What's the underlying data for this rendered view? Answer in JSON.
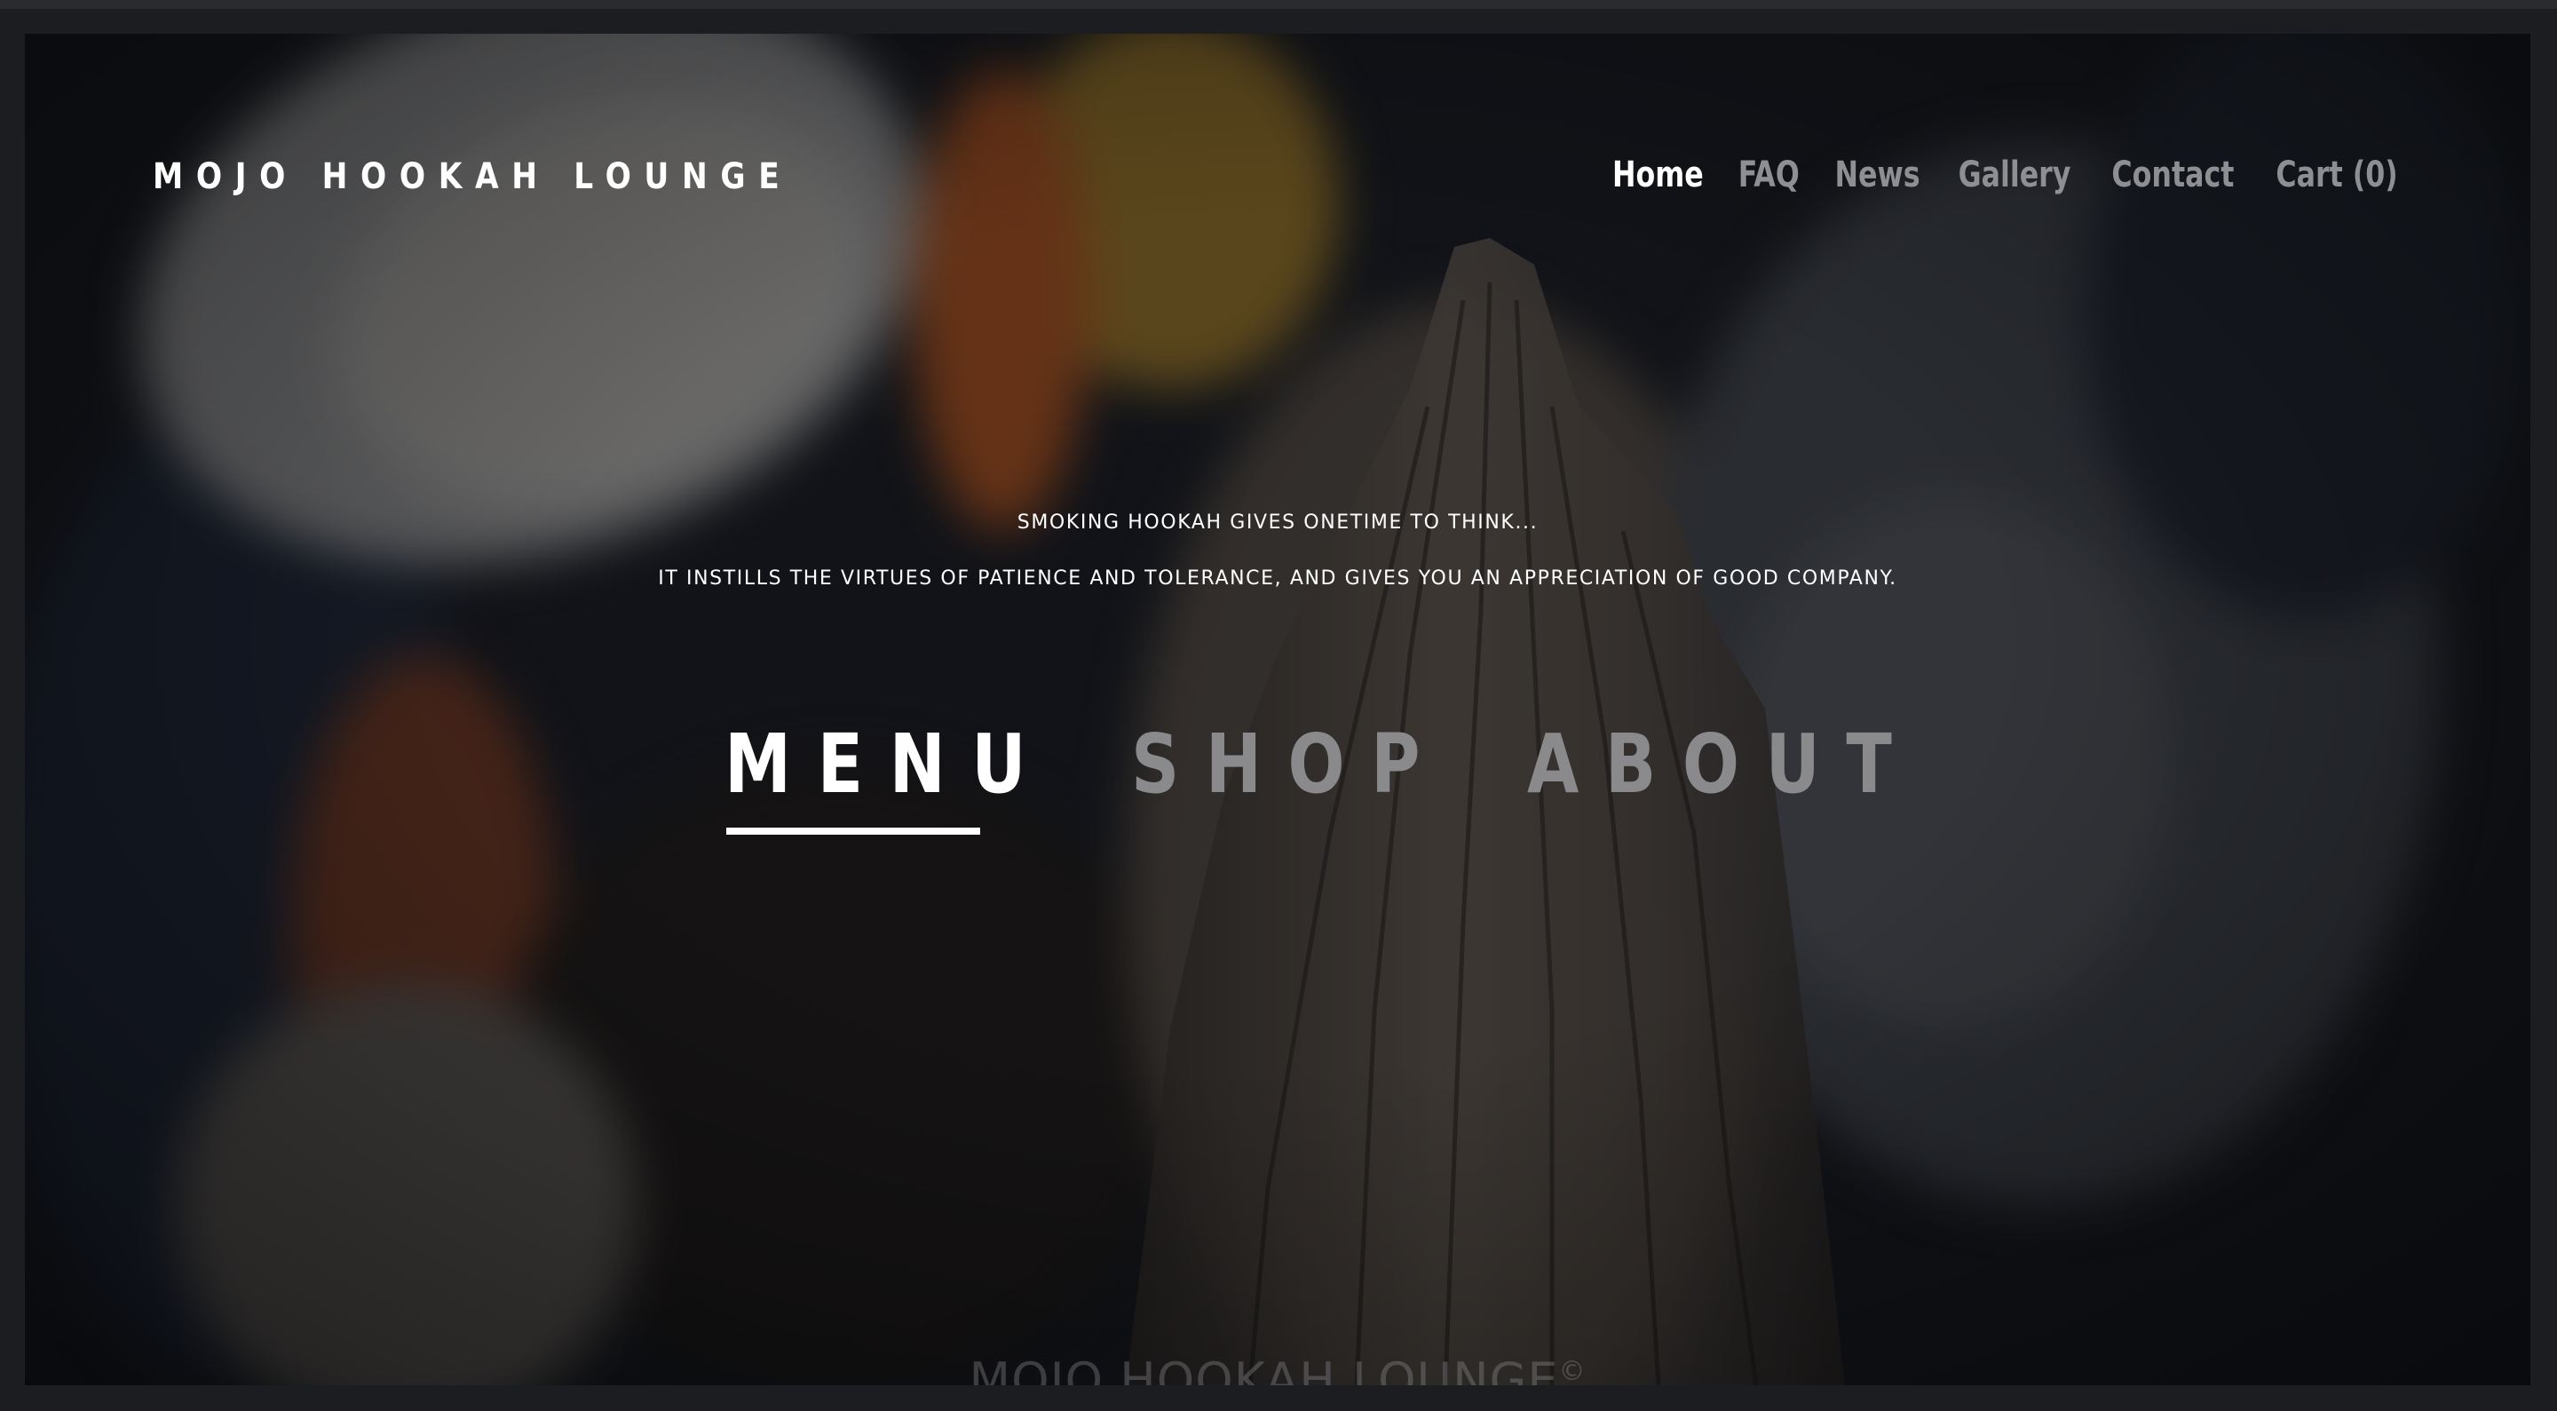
{
  "site": {
    "title": "MOJO HOOKAH LOUNGE"
  },
  "nav": {
    "items": [
      {
        "label": "Home",
        "active": true
      },
      {
        "label": "FAQ",
        "active": false
      },
      {
        "label": "News",
        "active": false
      },
      {
        "label": "Gallery",
        "active": false
      },
      {
        "label": "Contact",
        "active": false
      },
      {
        "label": "Cart (0)",
        "active": false
      }
    ]
  },
  "hero": {
    "tagline_line1": "SMOKING HOOKAH GIVES ONETIME TO THINK...",
    "tagline_line2": "IT INSTILLS THE VIRTUES OF PATIENCE AND TOLERANCE, AND GIVES YOU AN APPRECIATION OF GOOD COMPANY."
  },
  "sections": {
    "items": [
      {
        "label": "MENU",
        "active": true
      },
      {
        "label": "SHOP",
        "active": false
      },
      {
        "label": "ABOUT",
        "active": false
      }
    ]
  },
  "footer": {
    "watermark": "MOJO HOOKAH LOUNGE",
    "copyright_symbol": "©"
  },
  "colors": {
    "background": "#1c1d20",
    "text_active": "#ffffff",
    "text_inactive": "#8e8f92"
  },
  "icons": {
    "hero_image": "blurred-hookah-closeup-image"
  }
}
